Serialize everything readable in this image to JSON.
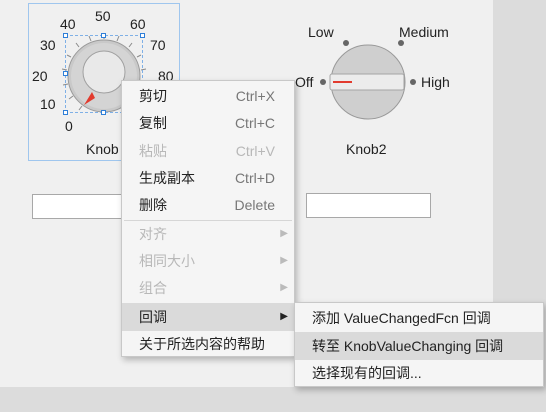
{
  "knob1": {
    "ticks": [
      "0",
      "10",
      "20",
      "30",
      "40",
      "50",
      "60",
      "70",
      "80"
    ],
    "label": "Knob"
  },
  "knob2": {
    "states": [
      "Off",
      "Low",
      "Medium",
      "High"
    ],
    "selected": "Off",
    "label": "Knob2"
  },
  "context_menu": {
    "items": [
      {
        "label": "剪切",
        "shortcut": "Ctrl+X",
        "enabled": true
      },
      {
        "label": "复制",
        "shortcut": "Ctrl+C",
        "enabled": true
      },
      {
        "label": "粘贴",
        "shortcut": "Ctrl+V",
        "enabled": false
      },
      {
        "label": "生成副本",
        "shortcut": "Ctrl+D",
        "enabled": true
      },
      {
        "label": "删除",
        "shortcut": "Delete",
        "enabled": true
      },
      {
        "label": "对齐",
        "enabled": false,
        "submenu": true
      },
      {
        "label": "相同大小",
        "enabled": false,
        "submenu": true
      },
      {
        "label": "组合",
        "enabled": false,
        "submenu": true
      },
      {
        "label": "回调",
        "enabled": true,
        "submenu": true,
        "highlighted": true
      },
      {
        "label": "关于所选内容的帮助",
        "enabled": true
      }
    ]
  },
  "callback_submenu": {
    "items": [
      {
        "label": "添加 ValueChangedFcn 回调"
      },
      {
        "label": "转至 KnobValueChanging 回调",
        "highlighted": true
      },
      {
        "label": "选择现有的回调..."
      }
    ]
  },
  "colors": {
    "selection": "#2f7fd8",
    "pointer": "#e23b2e",
    "menu_hover": "#dadada"
  }
}
